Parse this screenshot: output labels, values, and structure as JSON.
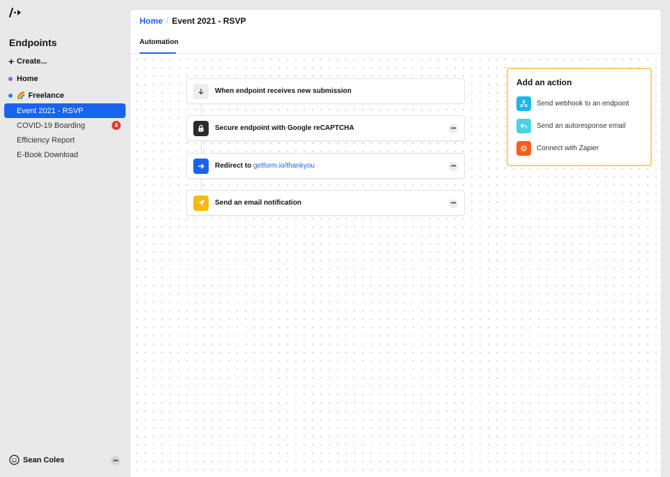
{
  "sidebar": {
    "title": "Endpoints",
    "create_label": "Create...",
    "groups": [
      {
        "label": "Home",
        "dot_color": "#9b59f5",
        "emoji": ""
      },
      {
        "label": "Freelance",
        "dot_color": "#1e88e5",
        "emoji": "🌈"
      }
    ],
    "items": [
      {
        "label": "Event 2021 - RSVP",
        "active": true
      },
      {
        "label": "COVID-19 Boarding",
        "badge": "4"
      },
      {
        "label": "Efficiency Report"
      },
      {
        "label": "E-Book Download"
      }
    ],
    "user": {
      "name": "Sean Coles",
      "more": "•••"
    }
  },
  "header": {
    "breadcrumb_home": "Home",
    "breadcrumb_sep": "/",
    "breadcrumb_current": "Event 2021 - RSVP",
    "tabs": [
      {
        "label": "Automation",
        "active": true
      }
    ]
  },
  "steps": [
    {
      "label": "When endpoint receives new submission",
      "icon": "arrow-down-icon",
      "color": "#ededed"
    },
    {
      "label": "Secure endpoint with Google reCAPTCHA",
      "icon": "lock-icon",
      "color": "#2b2b2b",
      "more": "•••"
    },
    {
      "label_prefix": "Redirect to ",
      "link": "getform.io/thankyou",
      "icon": "arrow-right-icon",
      "color": "#1863f0",
      "more": "•••"
    },
    {
      "label": "Send an email notification",
      "icon": "send-icon",
      "color": "#f9b811",
      "more": "•••"
    }
  ],
  "actions_panel": {
    "title": "Add an action",
    "items": [
      {
        "label": "Send webhook to an endpoint",
        "icon": "webhook-icon",
        "color": "#1fb6ea"
      },
      {
        "label": "Send an autoresponse email",
        "icon": "reply-icon",
        "color": "#4dd0e1"
      },
      {
        "label": "Connect with Zapier",
        "icon": "zapier-icon",
        "color": "#ff5a1f"
      }
    ]
  },
  "colors": {
    "accent": "#1863f0",
    "highlight_border": "#f6d064",
    "badge": "#e53935"
  }
}
